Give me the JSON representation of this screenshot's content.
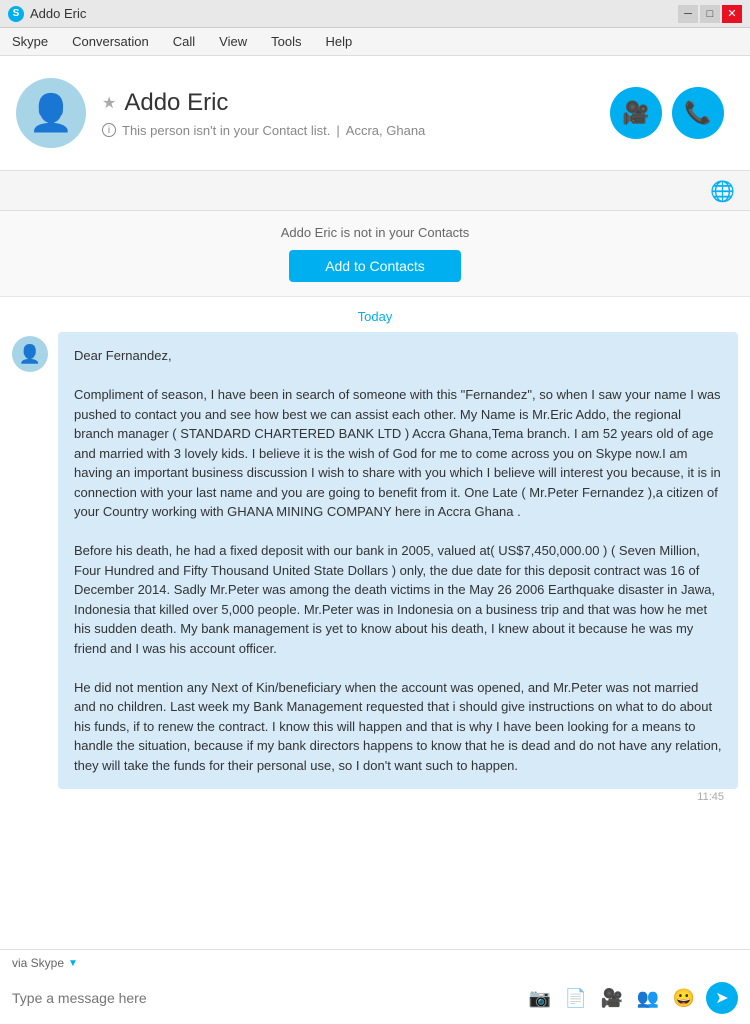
{
  "titlebar": {
    "title": "Addo Eric",
    "icon": "S",
    "minimize": "─",
    "maximize": "□",
    "close": "✕"
  },
  "menubar": {
    "items": [
      "Skype",
      "Conversation",
      "Call",
      "View",
      "Tools",
      "Help"
    ]
  },
  "profile": {
    "name": "Addo Eric",
    "status": "This person isn't in your Contact list.",
    "location": "Accra, Ghana"
  },
  "not_in_contacts": {
    "message": "Addo Eric is not in your Contacts",
    "button": "Add to Contacts"
  },
  "chat": {
    "date_separator": "Today",
    "message_time": "11:45",
    "message_body": "Dear Fernandez,\n\nCompliment of season, I have been in search of someone with this \"Fernandez\", so when I saw your name I was pushed to contact you and see how best we can assist each other. My Name is Mr.Eric Addo, the regional branch manager ( STANDARD CHARTERED BANK LTD ) Accra Ghana,Tema branch. I am 52 years old of age and married with 3 lovely kids. I believe it is the wish of God for me to come across you on Skype now.I am having an important business discussion I wish to share with you which I believe will interest you because, it is in connection with your last name and you are going to benefit from it. One Late ( Mr.Peter Fernandez ),a citizen of your Country working with GHANA MINING COMPANY here in Accra Ghana .\n\nBefore his death, he had a fixed deposit with our bank in 2005, valued at( US$7,450,000.00 ) ( Seven Million, Four Hundred and Fifty Thousand United State Dollars ) only, the due date for this deposit contract was 16 of December 2014. Sadly Mr.Peter was among the death victims in the May 26 2006 Earthquake disaster in Jawa, Indonesia that killed over 5,000 people. Mr.Peter was in Indonesia on a business trip and that was how he met his sudden death. My bank management is yet to know about his death, I knew about it because he was my friend and I was his account officer.\n\nHe did not mention any Next of Kin/beneficiary when the account was opened, and Mr.Peter was not married and no children. Last week my Bank Management requested that i should give instructions on what to do about his funds, if to renew the contract. I know this will happen and that is why I have been looking for a means to handle the situation, because if my bank directors happens to know that he is dead and do not have any relation, they will take the funds for their personal use, so I don't want such to happen."
  },
  "input": {
    "placeholder": "Type a message here",
    "via_label": "via Skype"
  },
  "colors": {
    "accent": "#00aff0",
    "bubble": "#d6eaf8",
    "avatar_bg": "#a8d4e8"
  }
}
